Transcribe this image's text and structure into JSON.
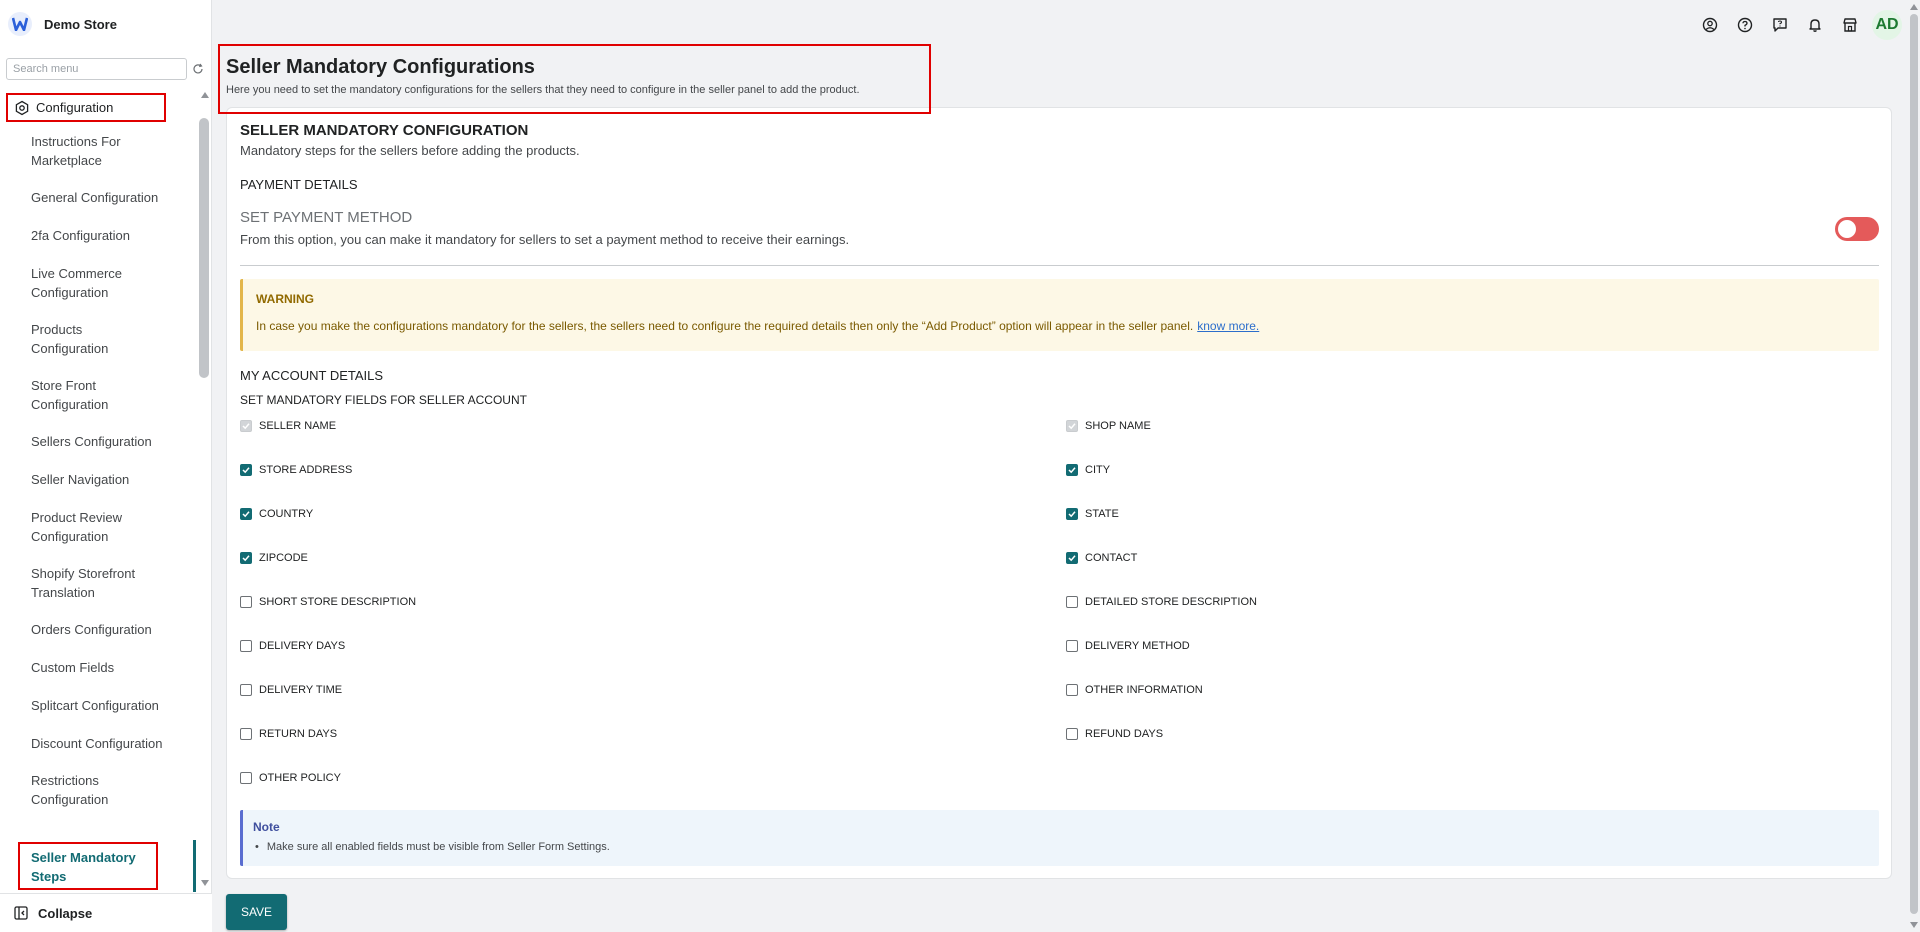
{
  "sidebar": {
    "store_name": "Demo Store",
    "search_placeholder": "Search menu",
    "section_label": "Configuration",
    "items": [
      {
        "label": "Instructions For Marketplace",
        "lines": 2
      },
      {
        "label": "General Configuration",
        "lines": 1
      },
      {
        "label": "2fa Configuration",
        "lines": 1
      },
      {
        "label": "Live Commerce Configuration",
        "lines": 2
      },
      {
        "label": "Products Configuration",
        "lines": 2
      },
      {
        "label": "Store Front Configuration",
        "lines": 2
      },
      {
        "label": "Sellers Configuration",
        "lines": 1
      },
      {
        "label": "Seller Navigation",
        "lines": 1
      },
      {
        "label": "Product Review Configuration",
        "lines": 2
      },
      {
        "label": "Shopify Storefront Translation",
        "lines": 2
      },
      {
        "label": "Orders Configuration",
        "lines": 1
      },
      {
        "label": "Custom Fields",
        "lines": 1
      },
      {
        "label": "Splitcart Configuration",
        "lines": 1
      },
      {
        "label": "Discount Configuration",
        "lines": 2
      },
      {
        "label": "Restrictions Configuration",
        "lines": 2
      }
    ],
    "active_item": "Seller Mandatory Steps",
    "collapse_label": "Collapse"
  },
  "topbar": {
    "icons": [
      "account-circle-icon",
      "help-icon",
      "feedback-icon",
      "bell-icon",
      "store-icon"
    ],
    "avatar_initials": "AD"
  },
  "page": {
    "title": "Seller Mandatory Configurations",
    "description": "Here you need to set the mandatory configurations for the sellers that they need to configure in the seller panel to add the product."
  },
  "card": {
    "section_title": "SELLER MANDATORY CONFIGURATION",
    "section_desc": "Mandatory steps for the sellers before adding the products.",
    "payment_heading": "PAYMENT DETAILS",
    "payment_method_title": "SET PAYMENT METHOD",
    "payment_method_desc": "From this option, you can make it mandatory for sellers to set a payment method to receive their earnings.",
    "payment_toggle_on": false,
    "warning": {
      "title": "WARNING",
      "body": "In case you make the configurations mandatory for the sellers, the sellers need to configure the required details then only the “Add Product” option will appear in the seller panel.",
      "link": "know more."
    },
    "account_heading": "MY ACCOUNT DETAILS",
    "fields_heading": "SET MANDATORY FIELDS FOR SELLER ACCOUNT",
    "fields_left": [
      {
        "label": "SELLER NAME",
        "state": "disabled"
      },
      {
        "label": "STORE ADDRESS",
        "state": "checked"
      },
      {
        "label": "COUNTRY",
        "state": "checked"
      },
      {
        "label": "ZIPCODE",
        "state": "checked"
      },
      {
        "label": "SHORT STORE DESCRIPTION",
        "state": "unchecked"
      },
      {
        "label": "DELIVERY DAYS",
        "state": "unchecked"
      },
      {
        "label": "DELIVERY TIME",
        "state": "unchecked"
      },
      {
        "label": "RETURN DAYS",
        "state": "unchecked"
      },
      {
        "label": "OTHER POLICY",
        "state": "unchecked"
      }
    ],
    "fields_right": [
      {
        "label": "SHOP NAME",
        "state": "disabled"
      },
      {
        "label": "CITY",
        "state": "checked"
      },
      {
        "label": "STATE",
        "state": "checked"
      },
      {
        "label": "CONTACT",
        "state": "checked"
      },
      {
        "label": "DETAILED STORE DESCRIPTION",
        "state": "unchecked"
      },
      {
        "label": "DELIVERY METHOD",
        "state": "unchecked"
      },
      {
        "label": "OTHER INFORMATION",
        "state": "unchecked"
      },
      {
        "label": "REFUND DAYS",
        "state": "unchecked"
      }
    ],
    "note": {
      "title": "Note",
      "body": "Make sure all enabled fields must be visible from Seller Form Settings."
    }
  },
  "save_label": "SAVE",
  "colors": {
    "accent": "#126b73",
    "toggle_off": "#e45a5a",
    "highlight_border": "#e00000",
    "warning_bg": "#fdf8e6",
    "note_bg": "#eef5fb"
  }
}
